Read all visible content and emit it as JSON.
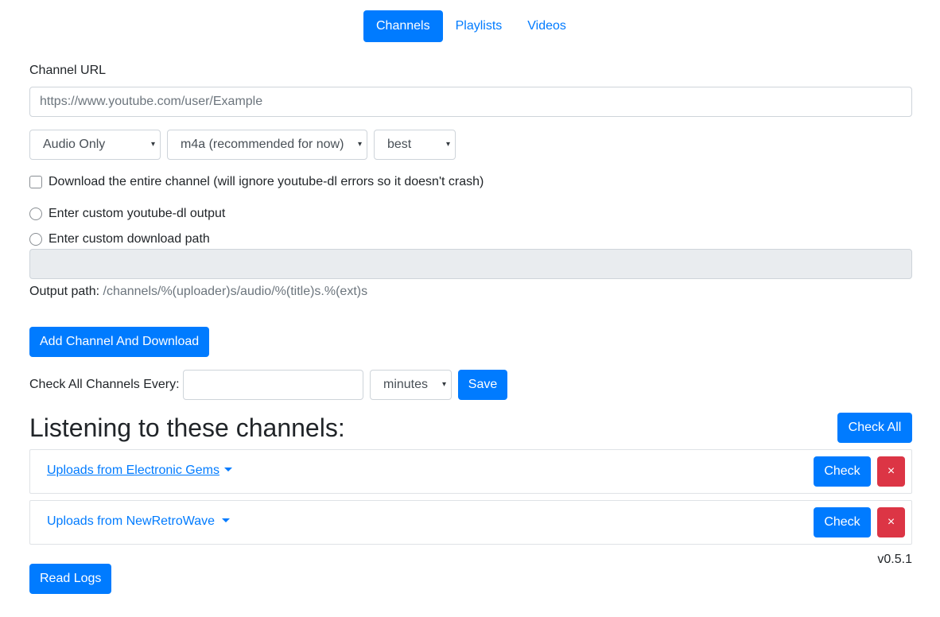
{
  "nav": {
    "tabs": [
      {
        "label": "Channels",
        "active": true
      },
      {
        "label": "Playlists",
        "active": false
      },
      {
        "label": "Videos",
        "active": false
      }
    ]
  },
  "form": {
    "channel_url_label": "Channel URL",
    "channel_url_placeholder": "https://www.youtube.com/user/Example",
    "type_select": "Audio Only",
    "format_select": "m4a (recommended for now)",
    "quality_select": "best",
    "download_entire_label": "Download the entire channel (will ignore youtube-dl errors so it doesn't crash)",
    "custom_output_label": "Enter custom youtube-dl output",
    "custom_path_label": "Enter custom download path",
    "output_path_label": "Output path:",
    "output_path_value": "/channels/%(uploader)s/audio/%(title)s.%(ext)s",
    "add_button": "Add Channel And Download"
  },
  "schedule": {
    "label": "Check All Channels Every:",
    "interval_value": "",
    "unit_select": "minutes",
    "save_button": "Save"
  },
  "channels_section": {
    "title": "Listening to these channels:",
    "check_all_button": "Check All",
    "items": [
      {
        "name": "Uploads from Electronic Gems",
        "check_label": "Check",
        "delete_label": "×"
      },
      {
        "name": "Uploads from NewRetroWave",
        "check_label": "Check",
        "delete_label": "×"
      }
    ]
  },
  "footer": {
    "version": "v0.5.1",
    "read_logs_button": "Read Logs"
  },
  "colors": {
    "primary": "#007bff",
    "danger": "#dc3545",
    "disabled_input": "#e9ecef"
  },
  "icons": [
    "chevron-down-icon",
    "close-icon",
    "dropdown-caret-icon"
  ]
}
